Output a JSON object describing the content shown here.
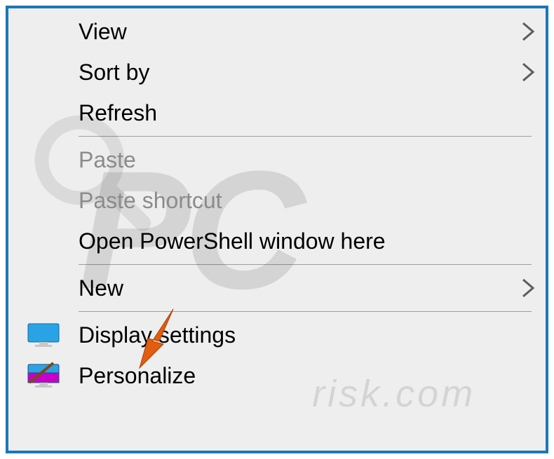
{
  "menu": {
    "items": [
      {
        "label": "View",
        "has_submenu": true,
        "enabled": true,
        "icon": null
      },
      {
        "label": "Sort by",
        "has_submenu": true,
        "enabled": true,
        "icon": null
      },
      {
        "label": "Refresh",
        "has_submenu": false,
        "enabled": true,
        "icon": null
      },
      {
        "sep": true
      },
      {
        "label": "Paste",
        "has_submenu": false,
        "enabled": false,
        "icon": null
      },
      {
        "label": "Paste shortcut",
        "has_submenu": false,
        "enabled": false,
        "icon": null
      },
      {
        "label": "Open PowerShell window here",
        "has_submenu": false,
        "enabled": true,
        "icon": null
      },
      {
        "sep": true
      },
      {
        "label": "New",
        "has_submenu": true,
        "enabled": true,
        "icon": null
      },
      {
        "sep": true
      },
      {
        "label": "Display settings",
        "has_submenu": false,
        "enabled": true,
        "icon": "monitor"
      },
      {
        "label": "Personalize",
        "has_submenu": false,
        "enabled": true,
        "icon": "personalize"
      }
    ]
  },
  "watermark": {
    "big": "PC",
    "small": "risk.com"
  },
  "callout": {
    "target_label": "Display settings"
  }
}
